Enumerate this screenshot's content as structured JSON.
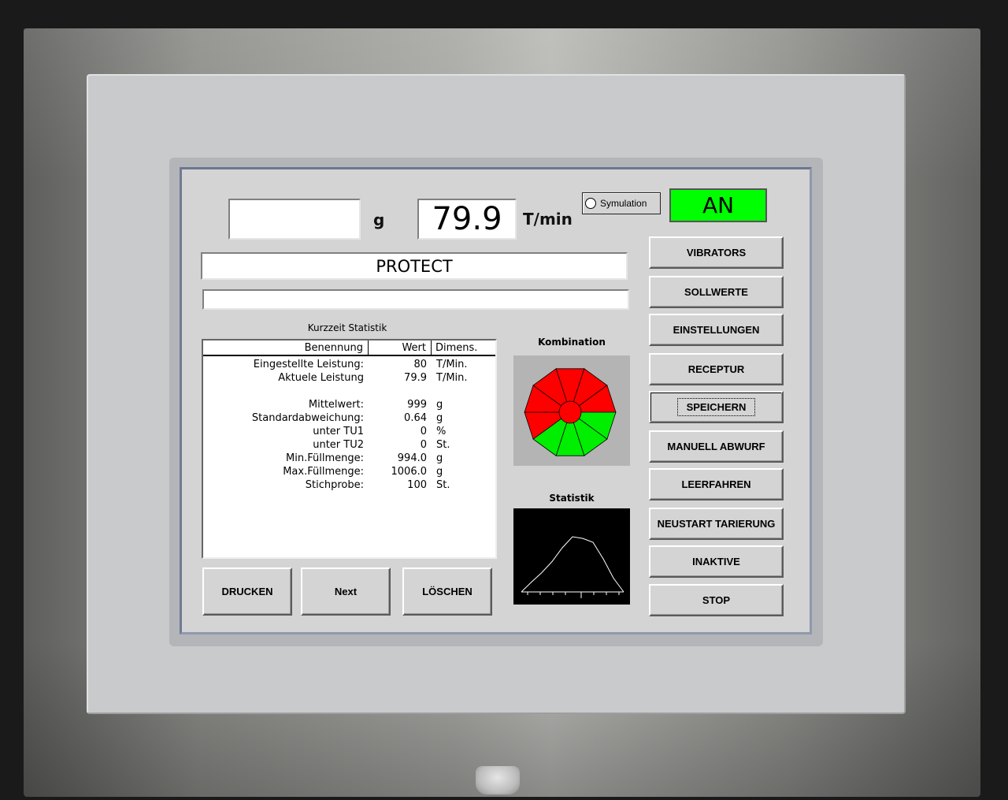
{
  "header": {
    "weight_value": "",
    "weight_unit": "g",
    "speed_value": "79.9",
    "speed_unit": "T/min",
    "simulation_label": "Symulation",
    "status_label": "AN",
    "status_color": "#00ff00"
  },
  "product_name": "PROTECT",
  "message_line": "",
  "stats": {
    "title": "Kurzzeit Statistik",
    "columns": [
      "Benennung",
      "Wert",
      "Dimens."
    ],
    "rows": [
      {
        "name": "Eingestellte Leistung:",
        "value": "80",
        "dim": "T/Min."
      },
      {
        "name": "Aktuele Leistung",
        "value": "79.9",
        "dim": "T/Min."
      },
      {
        "name": "",
        "value": "",
        "dim": ""
      },
      {
        "name": "Mittelwert:",
        "value": "999",
        "dim": "g"
      },
      {
        "name": "Standardabweichung:",
        "value": "0.64",
        "dim": "g"
      },
      {
        "name": "unter TU1",
        "value": "0",
        "dim": "%"
      },
      {
        "name": "unter TU2",
        "value": "0",
        "dim": "St."
      },
      {
        "name": "Min.Füllmenge:",
        "value": "994.0",
        "dim": "g"
      },
      {
        "name": "Max.Füllmenge:",
        "value": "1006.0",
        "dim": "g"
      },
      {
        "name": "Stichprobe:",
        "value": "100",
        "dim": "St."
      }
    ]
  },
  "bottom_buttons": {
    "print": "DRUCKEN",
    "next": "Next",
    "delete": "LÖSCHEN"
  },
  "combination": {
    "title": "Kombination",
    "segments": [
      "red",
      "red",
      "red",
      "green",
      "green",
      "green",
      "green",
      "red",
      "red",
      "red"
    ],
    "center": "red",
    "colors": {
      "red": "#ff0000",
      "green": "#00ee00",
      "background": "#b4b4b4"
    }
  },
  "statistik": {
    "title": "Statistik",
    "curve": [
      0,
      0.18,
      0.35,
      0.55,
      0.8,
      1.0,
      0.97,
      0.9,
      0.6,
      0.25,
      0
    ]
  },
  "menu": {
    "items": [
      "VIBRATORS",
      "SOLLWERTE",
      "EINSTELLUNGEN",
      "RECEPTUR",
      "SPEICHERN",
      "MANUELL ABWURF",
      "LEERFAHREN",
      "NEUSTART TARIERUNG",
      "INAKTIVE",
      "STOP"
    ],
    "focused_index": 4
  }
}
